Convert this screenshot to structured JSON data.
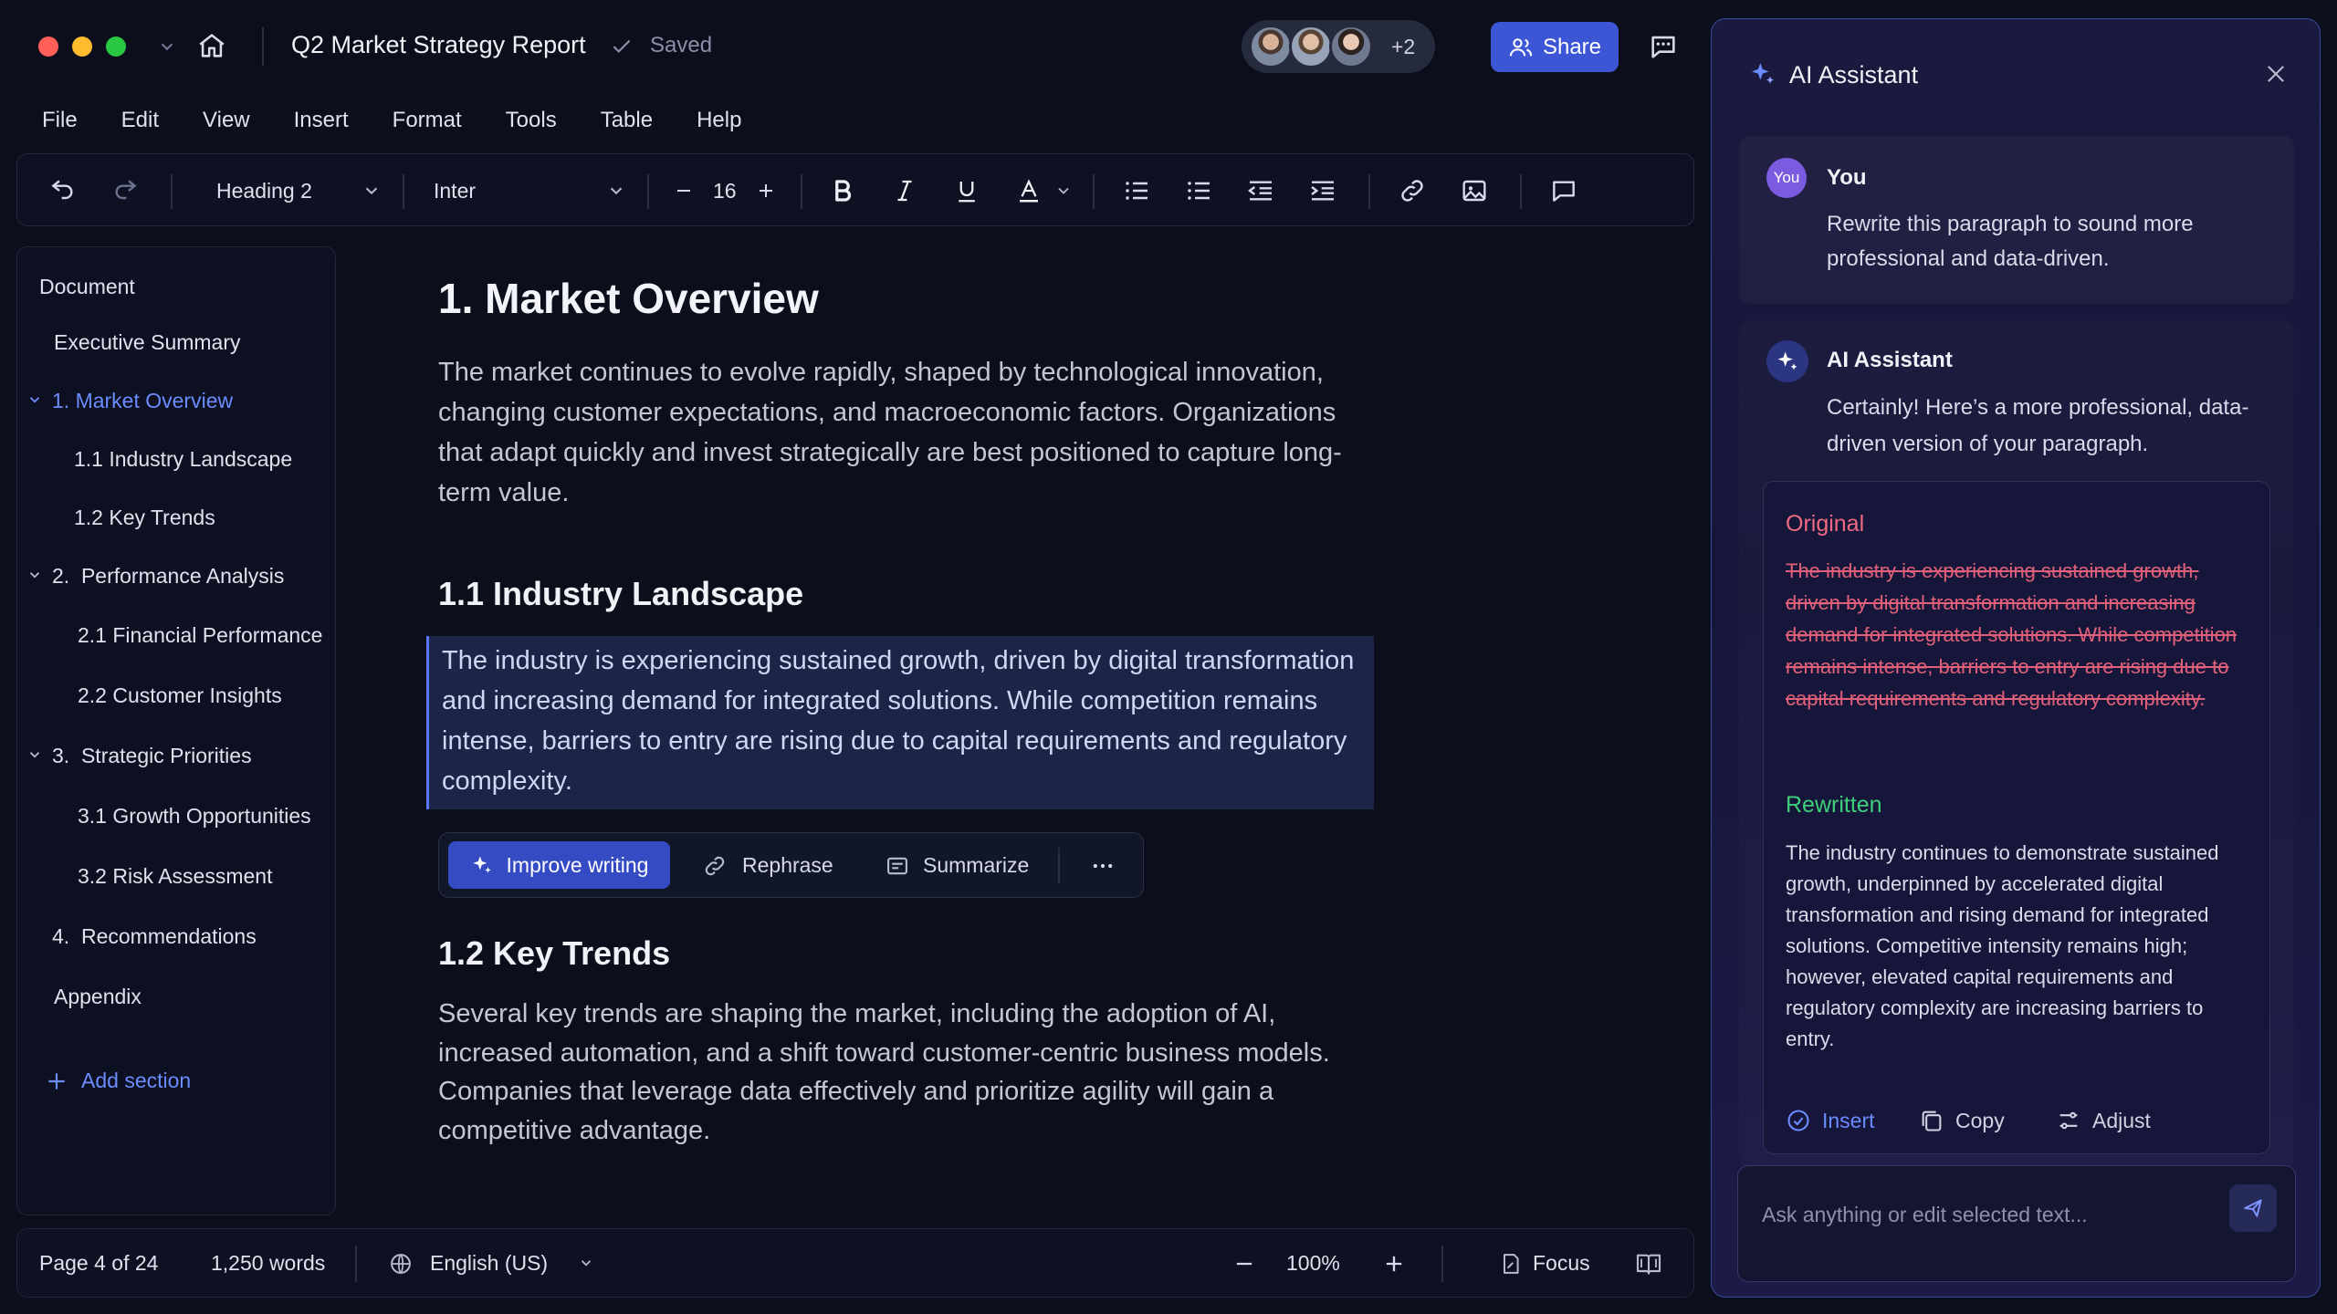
{
  "window": {
    "title": "Q2 Market Strategy Report",
    "saved_status": "Saved",
    "collaborators_extra": "+2",
    "share_label": "Share"
  },
  "menu": [
    "File",
    "Edit",
    "View",
    "Insert",
    "Format",
    "Tools",
    "Table",
    "Help"
  ],
  "toolbar": {
    "block_style": "Heading 2",
    "font_family": "Inter",
    "font_size": "16"
  },
  "sidebar": {
    "header": "Document",
    "items": [
      {
        "label": "Executive Summary"
      },
      {
        "label": "1. Market Overview",
        "active": true,
        "expanded": true
      },
      {
        "label": "1.1 Industry Landscape"
      },
      {
        "label": "1.2 Key Trends"
      },
      {
        "label": "2.  Performance Analysis",
        "expanded": true
      },
      {
        "label": "2.1 Financial Performance"
      },
      {
        "label": "2.2 Customer Insights"
      },
      {
        "label": "3.  Strategic Priorities",
        "expanded": true
      },
      {
        "label": "3.1 Growth Opportunities"
      },
      {
        "label": "3.2 Risk Assessment"
      },
      {
        "label": "4.  Recommendations"
      },
      {
        "label": "Appendix"
      }
    ],
    "add_section": "Add section"
  },
  "document": {
    "h1": "1. Market Overview",
    "p1": "The market continues to evolve rapidly, shaped by technological innovation, changing customer expectations, and macroeconomic factors. Organizations that adapt quickly and invest strategically are best positioned to capture long-term value.",
    "h2a": "1.1 Industry Landscape",
    "p2_selected": "The industry is experiencing sustained growth, driven by digital transformation and increasing demand for integrated solutions. While competition remains intense, barriers to entry are rising due to capital requirements and regulatory complexity.",
    "h2b": "1.2 Key Trends",
    "p3": "Several key trends are shaping the market, including the adoption of AI, increased automation, and a shift toward customer-centric business models. Companies that leverage data effectively and prioritize agility will gain a competitive advantage."
  },
  "floating_toolbar": {
    "improve": "Improve writing",
    "rephrase": "Rephrase",
    "summarize": "Summarize"
  },
  "statusbar": {
    "page": "Page 4 of 24",
    "words": "1,250 words",
    "language": "English (US)",
    "zoom": "100%",
    "focus": "Focus"
  },
  "assistant": {
    "title": "AI Assistant",
    "user_avatar": "You",
    "user_name": "You",
    "user_message": "Rewrite this paragraph to sound more professional and data-driven.",
    "ai_name": "AI Assistant",
    "ai_message": "Certainly! Here’s a more professional, data-driven version of your paragraph.",
    "original_label": "Original",
    "original_text": "The industry is experiencing sustained growth, driven by digital transformation and increasing demand for integrated solutions. While competition remains intense, barriers to entry are rising due to capital requirements and regulatory complexity.",
    "rewritten_label": "Rewritten",
    "rewritten_text": "The industry continues to demonstrate sustained growth, underpinned by accelerated digital transformation and rising demand for integrated solutions. Competitive intensity remains high; however, elevated capital requirements and regulatory complexity are increasing barriers to entry.",
    "insert": "Insert",
    "copy": "Copy",
    "adjust": "Adjust",
    "input_placeholder": "Ask anything or edit selected text..."
  },
  "colors": {
    "accent": "#3d56d6",
    "active_nav": "#6b8cff",
    "original": "#e0607a",
    "rewritten": "#3ecf7a"
  }
}
